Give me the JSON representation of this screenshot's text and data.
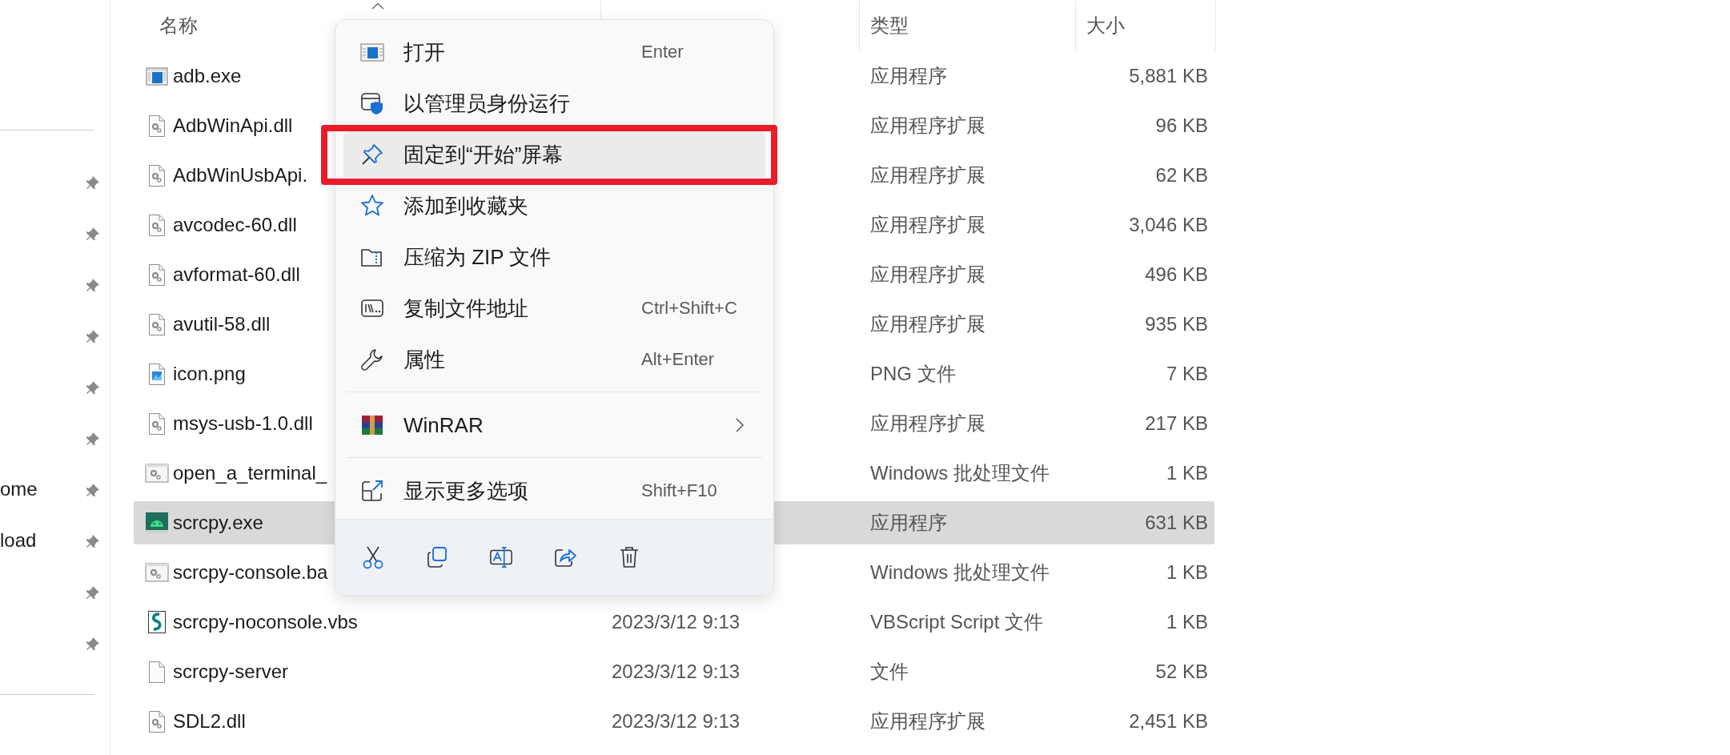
{
  "sidebar": {
    "items": [
      {
        "pinned": true
      },
      {
        "pinned": true
      },
      {
        "pinned": true
      },
      {
        "pinned": true
      },
      {
        "pinned": true
      },
      {
        "pinned": true
      },
      {
        "label": "ome",
        "pinned": true
      },
      {
        "label": "load",
        "pinned": true
      },
      {
        "pinned": true
      },
      {
        "pinned": true
      }
    ]
  },
  "file_list": {
    "columns": [
      {
        "label": "名称",
        "sorted": true
      },
      {
        "label": "类型"
      },
      {
        "label": "大小"
      }
    ],
    "rows": [
      {
        "kind": "app",
        "name": "adb.exe",
        "type": "应用程序",
        "size": "5,881 KB",
        "selected": false
      },
      {
        "kind": "dll",
        "name": "AdbWinApi.dll",
        "type": "应用程序扩展",
        "size": "96 KB",
        "selected": false
      },
      {
        "kind": "dll",
        "name": "AdbWinUsbApi.",
        "type": "应用程序扩展",
        "size": "62 KB",
        "selected": false
      },
      {
        "kind": "dll",
        "name": "avcodec-60.dll",
        "type": "应用程序扩展",
        "size": "3,046 KB",
        "selected": false
      },
      {
        "kind": "dll",
        "name": "avformat-60.dll",
        "type": "应用程序扩展",
        "size": "496 KB",
        "selected": false
      },
      {
        "kind": "dll",
        "name": "avutil-58.dll",
        "type": "应用程序扩展",
        "size": "935 KB",
        "selected": false
      },
      {
        "kind": "image",
        "name": "icon.png",
        "type": "PNG 文件",
        "size": "7 KB",
        "selected": false
      },
      {
        "kind": "dll",
        "name": "msys-usb-1.0.dll",
        "type": "应用程序扩展",
        "size": "217 KB",
        "selected": false
      },
      {
        "kind": "batch",
        "name": "open_a_terminal_",
        "type": "Windows 批处理文件",
        "size": "1 KB",
        "selected": false
      },
      {
        "kind": "android",
        "name": "scrcpy.exe",
        "type": "应用程序",
        "size": "631 KB",
        "selected": true
      },
      {
        "kind": "batch",
        "name": "scrcpy-console.ba",
        "type": "Windows 批处理文件",
        "size": "1 KB",
        "selected": false
      },
      {
        "kind": "script",
        "name": "scrcpy-noconsole.vbs",
        "date": "2023/3/12 9:13",
        "type": "VBScript Script 文件",
        "size": "1 KB",
        "selected": false
      },
      {
        "kind": "file",
        "name": "scrcpy-server",
        "date": "2023/3/12 9:13",
        "type": "文件",
        "size": "52 KB",
        "selected": false
      },
      {
        "kind": "dll",
        "name": "SDL2.dll",
        "date": "2023/3/12 9:13",
        "type": "应用程序扩展",
        "size": "2,451 KB",
        "selected": false
      }
    ]
  },
  "context_menu": {
    "items": [
      {
        "kind": "item",
        "label": "打开",
        "shortcut": "Enter",
        "selected": false
      },
      {
        "kind": "item",
        "label": "以管理员身份运行",
        "selected": false
      },
      {
        "kind": "item",
        "label": "固定到“开始”屏幕",
        "selected": true,
        "annotated": true
      },
      {
        "kind": "item",
        "label": "添加到收藏夹",
        "selected": false
      },
      {
        "kind": "item",
        "label": "压缩为 ZIP 文件",
        "selected": false
      },
      {
        "kind": "item",
        "label": "复制文件地址",
        "shortcut": "Ctrl+Shift+C",
        "selected": false
      },
      {
        "kind": "item",
        "label": "属性",
        "shortcut": "Alt+Enter",
        "selected": false
      },
      {
        "kind": "separator"
      },
      {
        "kind": "submenu",
        "label": "WinRAR",
        "selected": false
      },
      {
        "kind": "separator"
      },
      {
        "kind": "item",
        "label": "显示更多选项",
        "shortcut": "Shift+F10",
        "selected": false
      }
    ]
  }
}
